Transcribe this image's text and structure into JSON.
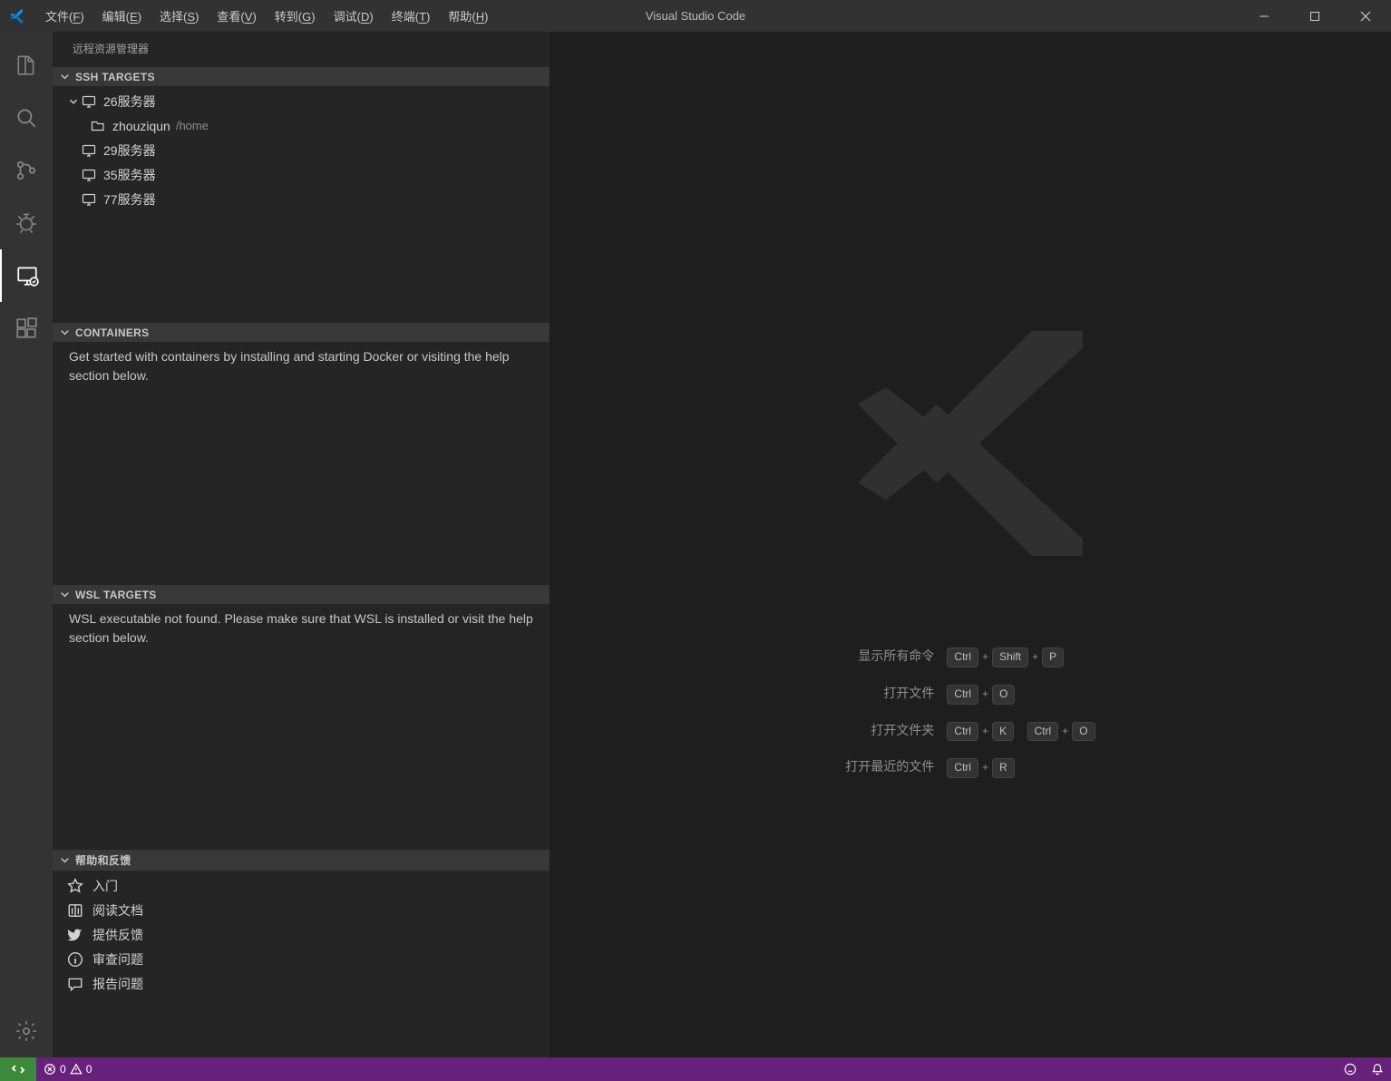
{
  "titlebar": {
    "title": "Visual Studio Code",
    "menu": [
      {
        "label": "文件",
        "mnemonic": "F"
      },
      {
        "label": "编辑",
        "mnemonic": "E"
      },
      {
        "label": "选择",
        "mnemonic": "S"
      },
      {
        "label": "查看",
        "mnemonic": "V"
      },
      {
        "label": "转到",
        "mnemonic": "G"
      },
      {
        "label": "调试",
        "mnemonic": "D"
      },
      {
        "label": "终端",
        "mnemonic": "T"
      },
      {
        "label": "帮助",
        "mnemonic": "H"
      }
    ]
  },
  "sidebar": {
    "title": "远程资源管理器",
    "ssh": {
      "header": "SSH TARGETS",
      "items": [
        {
          "name": "26服务器",
          "expanded": true,
          "children": [
            {
              "name": "zhouziqun",
              "path": "/home"
            }
          ]
        },
        {
          "name": "29服务器"
        },
        {
          "name": "35服务器"
        },
        {
          "name": "77服务器"
        }
      ]
    },
    "containers": {
      "header": "CONTAINERS",
      "message": "Get started with containers by installing and starting Docker or visiting the help section below."
    },
    "wsl": {
      "header": "WSL TARGETS",
      "message": "WSL executable not found. Please make sure that WSL is installed or visit the help section below."
    },
    "help": {
      "header": "帮助和反馈",
      "items": [
        {
          "label": "入门",
          "icon": "star"
        },
        {
          "label": "阅读文档",
          "icon": "book"
        },
        {
          "label": "提供反馈",
          "icon": "twitter"
        },
        {
          "label": "审查问题",
          "icon": "info"
        },
        {
          "label": "报告问题",
          "icon": "comment"
        }
      ]
    }
  },
  "editor": {
    "shortcuts": [
      {
        "label": "显示所有命令",
        "keys": [
          "Ctrl",
          "Shift",
          "P"
        ]
      },
      {
        "label": "打开文件",
        "keys": [
          "Ctrl",
          "O"
        ]
      },
      {
        "label": "打开文件夹",
        "keys": [
          "Ctrl",
          "K",
          "Ctrl",
          "O"
        ]
      },
      {
        "label": "打开最近的文件",
        "keys": [
          "Ctrl",
          "R"
        ]
      }
    ]
  },
  "statusbar": {
    "errors": "0",
    "warnings": "0"
  }
}
